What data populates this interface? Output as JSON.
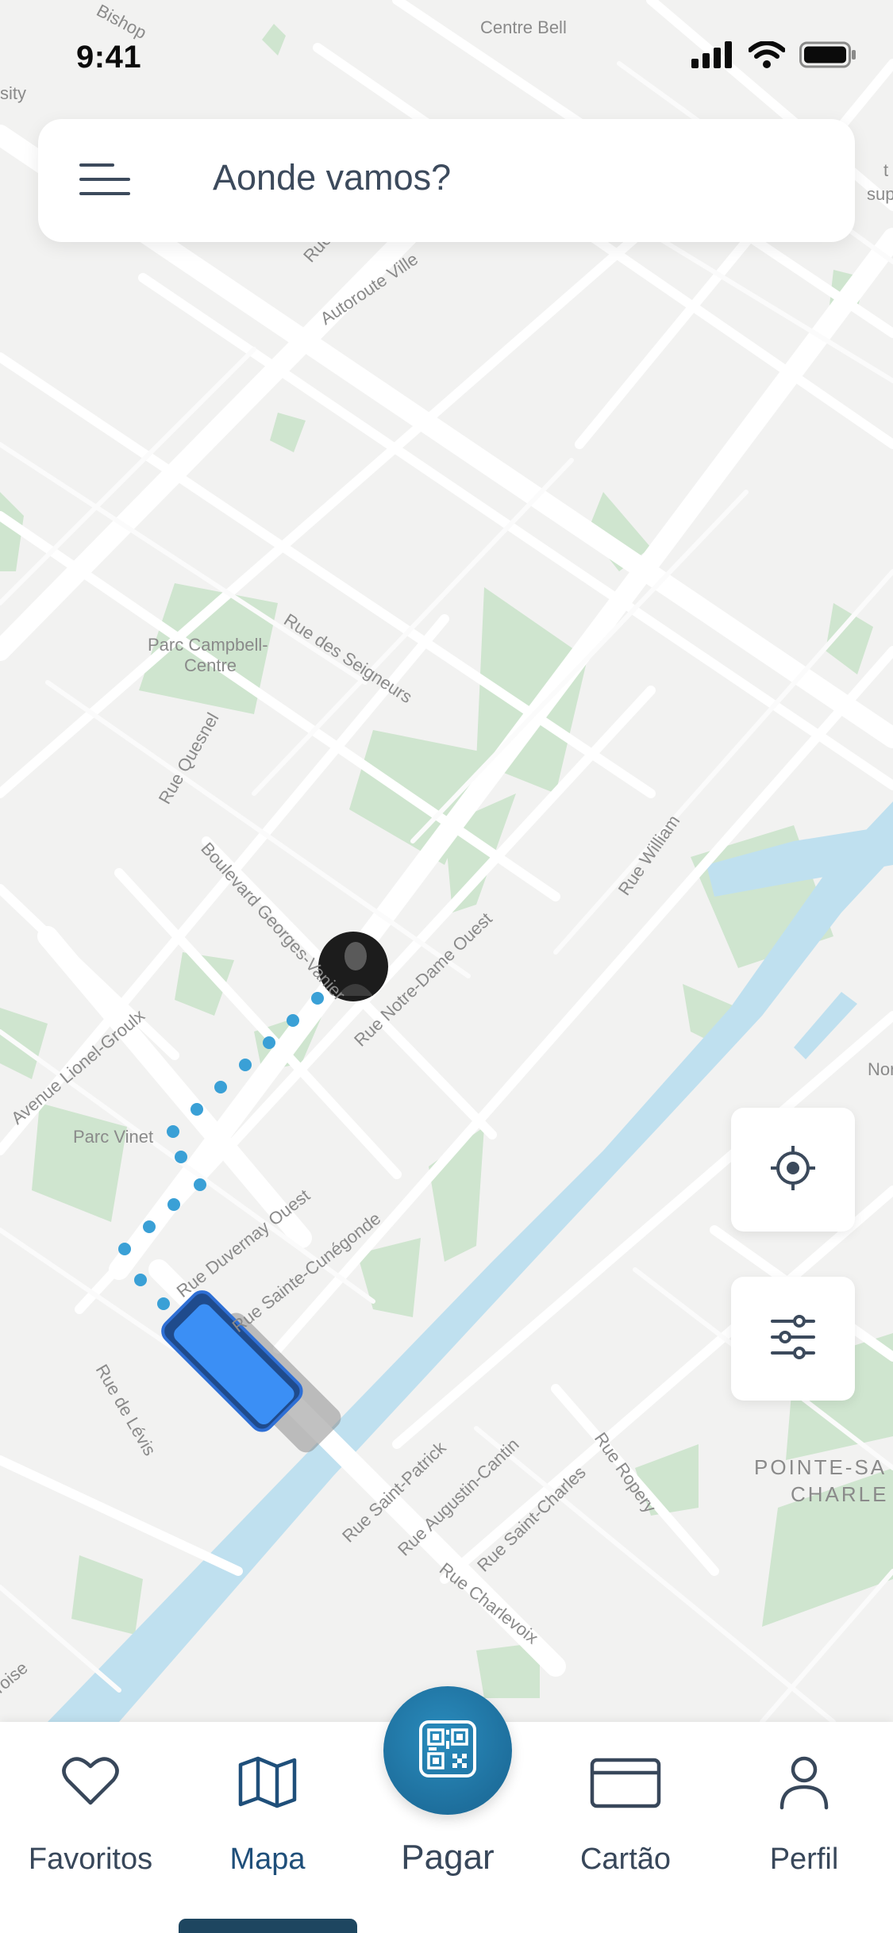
{
  "status_bar": {
    "time": "9:41"
  },
  "search": {
    "placeholder": "Aonde vamos?"
  },
  "map": {
    "labels": {
      "bishop": "Bishop",
      "centre_bell": "Centre Bell",
      "sity": "sity",
      "right_t": "t",
      "right_sup": "sup",
      "rue_top": "Rue",
      "autoroute_ville": "Autoroute Ville",
      "rue_des_seigneurs": "Rue des Seigneurs",
      "parc_campbell": "Parc Campbell-",
      "centre": "Centre",
      "rue_quesnel": "Rue Quesnel",
      "boulevard_georges_vanier": "Boulevard Georges-Vanier",
      "rue_notre_dame_ouest": "Rue Notre-Dame Ouest",
      "rue_william": "Rue William",
      "avenue_lionel_groulx": "Avenue Lionel-Groulx",
      "parc_vinet": "Parc Vinet",
      "rue_duvernay_ouest": "Rue Duvernay Ouest",
      "rue_sainte_cunegonde": "Rue Sainte-Cunégonde",
      "rue_de_levis": "Rue de Lévis",
      "rue_saint_patrick": "Rue Saint-Patrick",
      "rue_augustin_cantin": "Rue Augustin-Cantin",
      "rue_saint_charles": "Rue Saint-Charles",
      "rue_ropery": "Rue Ropery",
      "rue_charlevoix": "Rue Charlevoix",
      "pointe_sa": "POINTE-SA",
      "charle": "CHARLE",
      "nor": "Nor",
      "roise": "roise"
    }
  },
  "nav": {
    "favorites": "Favoritos",
    "map": "Mapa",
    "pay": "Pagar",
    "card": "Cartão",
    "profile": "Perfil"
  },
  "colors": {
    "accent": "#1f4f7a",
    "route": "#3aa0d6",
    "bus": "#3b8ff5",
    "water": "#bfe0ef",
    "park": "#cfe5cf"
  }
}
